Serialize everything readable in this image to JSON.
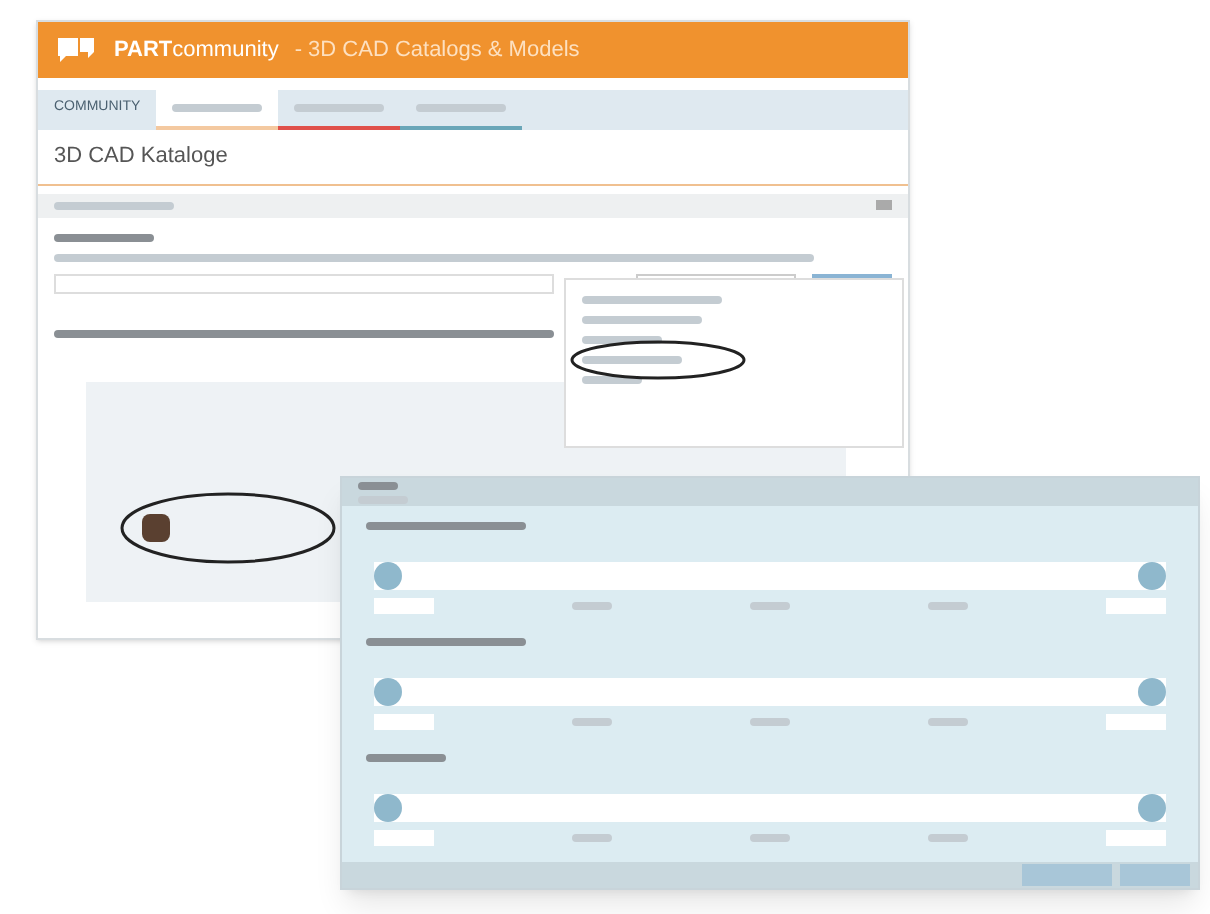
{
  "app": {
    "brand": "PART",
    "brand_suffix": "community",
    "title": "- 3D CAD Catalogs & Models"
  },
  "tabs": [
    {
      "label": "COMMUNITY",
      "selected": false,
      "color": "#dfe9f0"
    },
    {
      "selected": true,
      "color": "#f4c9a0"
    },
    {
      "selected": false,
      "color": "#e0504a"
    },
    {
      "selected": false,
      "color": "#6aa6b8"
    }
  ],
  "page_title": "3D CAD Kataloge",
  "dialog": {
    "sliders": [
      {
        "kind": "range",
        "level": 1
      },
      {
        "kind": "range",
        "level": 1
      },
      {
        "kind": "range",
        "level": 1
      }
    ]
  }
}
